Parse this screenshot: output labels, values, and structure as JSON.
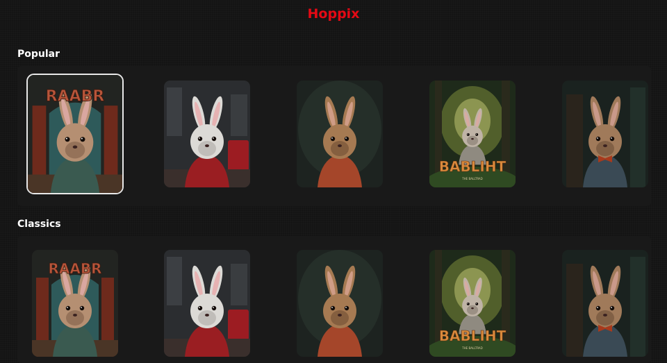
{
  "app": {
    "title": "Hoppix",
    "brand_color": "#e50914"
  },
  "rows": [
    {
      "title": "Popular",
      "items": [
        {
          "poster_style": "theater",
          "poster_text": "RAABR",
          "selected": true
        },
        {
          "poster_style": "red-shirt",
          "poster_text": "",
          "selected": false
        },
        {
          "poster_style": "portrait-brown",
          "poster_text": "",
          "selected": false
        },
        {
          "poster_style": "forest",
          "poster_text": "BABLIHT",
          "poster_subtext": "THE BALLTRAD",
          "selected": false
        },
        {
          "poster_style": "bowtie",
          "poster_text": "",
          "selected": false
        }
      ]
    },
    {
      "title": "Classics",
      "items": [
        {
          "poster_style": "theater",
          "poster_text": "RAABR",
          "selected": false
        },
        {
          "poster_style": "red-shirt",
          "poster_text": "",
          "selected": false
        },
        {
          "poster_style": "portrait-brown",
          "poster_text": "",
          "selected": false
        },
        {
          "poster_style": "forest",
          "poster_text": "BABLIHT",
          "poster_subtext": "THE BALLTRAD",
          "selected": false
        },
        {
          "poster_style": "bowtie",
          "poster_text": "",
          "selected": false
        }
      ]
    }
  ]
}
